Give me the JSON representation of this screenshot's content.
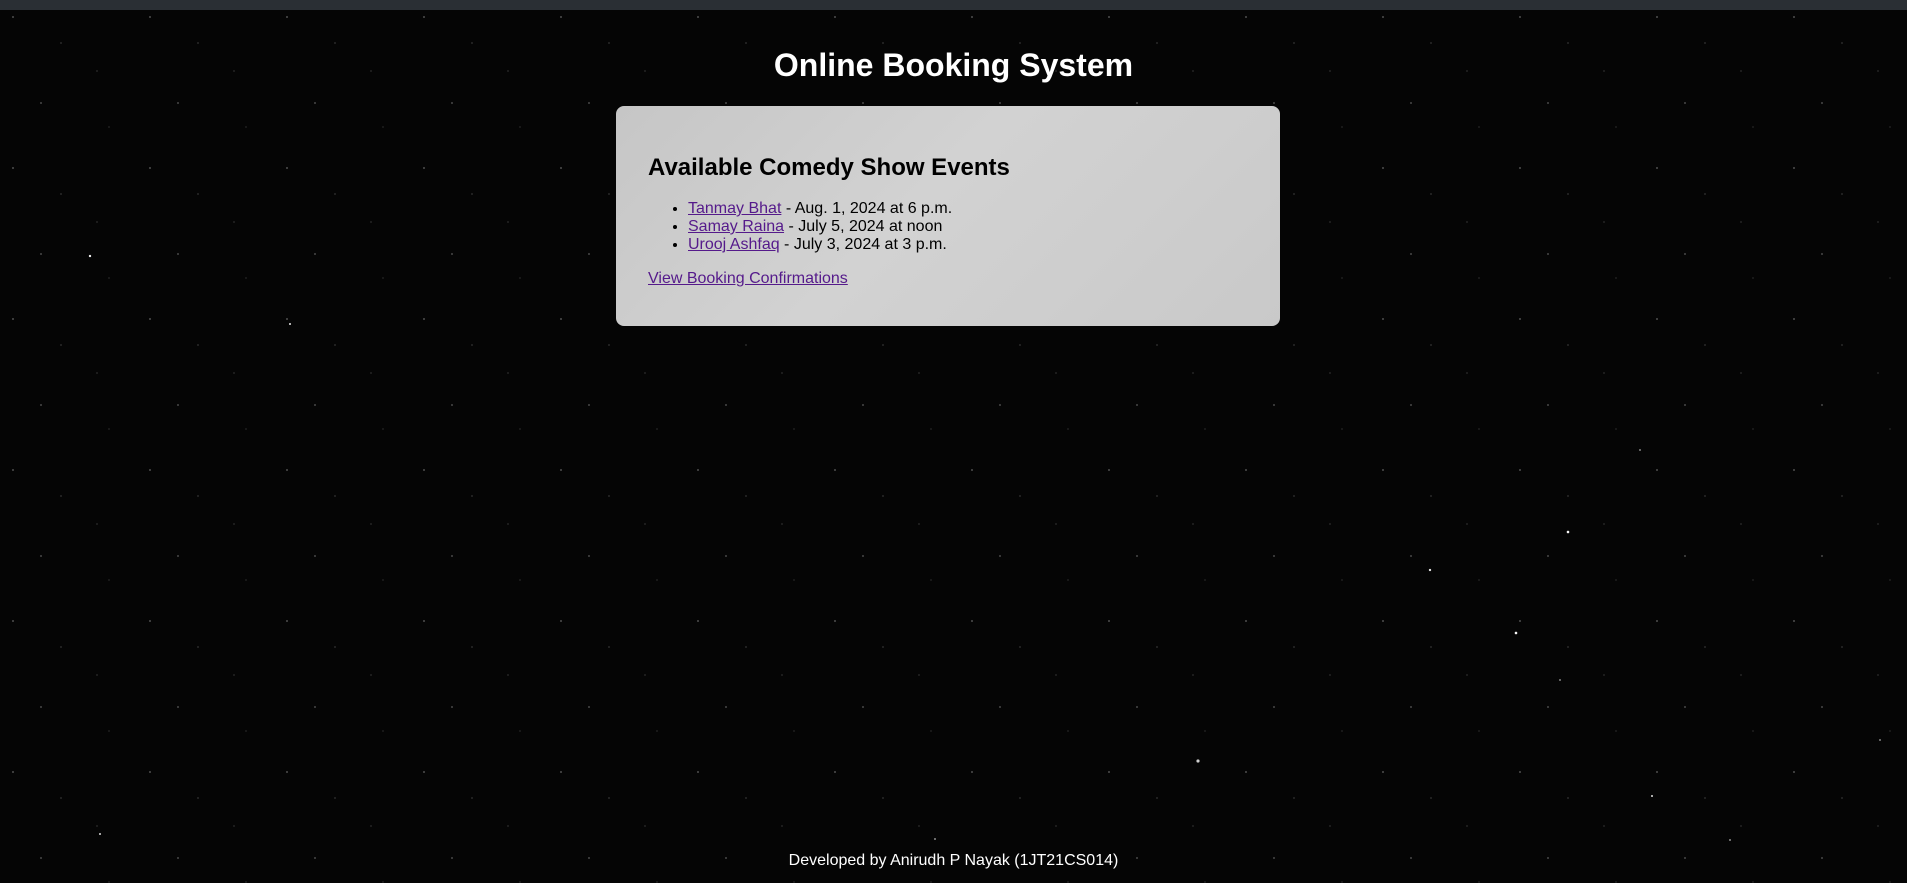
{
  "header": {
    "title": "Online Booking System"
  },
  "events": {
    "heading": "Available Comedy Show Events",
    "items": [
      {
        "name": "Tanmay Bhat",
        "schedule": " - Aug. 1, 2024 at 6 p.m."
      },
      {
        "name": "Samay Raina",
        "schedule": " - July 5, 2024 at noon"
      },
      {
        "name": "Urooj Ashfaq",
        "schedule": " - July 3, 2024 at 3 p.m."
      }
    ],
    "confirmations_link": "View Booking Confirmations"
  },
  "footer": {
    "credit": "Developed by Anirudh P Nayak (1JT21CS014)"
  },
  "colors": {
    "background": "#050505",
    "card": "#cccccc",
    "visited_link": "#551a8b",
    "title_text": "#ffffff"
  }
}
